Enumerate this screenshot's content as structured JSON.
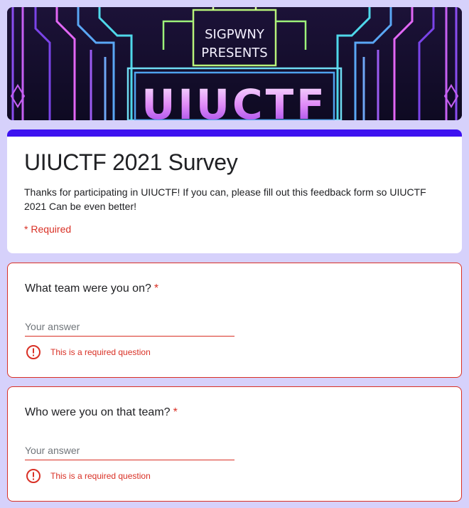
{
  "banner": {
    "line1": "SIGPWNY",
    "line2": "PRESENTS",
    "logo": "UIUCTF"
  },
  "form": {
    "title": "UIUCTF 2021 Survey",
    "description": "Thanks for participating in UIUCTF! If you can, please fill out this feedback form so UIUCTF 2021 Can be even better!",
    "required_note": "* Required"
  },
  "questions": [
    {
      "label": "What team were you on?",
      "required_mark": "*",
      "placeholder": "Your answer",
      "error": "This is a required question"
    },
    {
      "label": "Who were you on that team?",
      "required_mark": "*",
      "placeholder": "Your answer",
      "error": "This is a required question"
    }
  ],
  "colors": {
    "page_bg": "#d6d1fb",
    "accent": "#3d12f0",
    "error": "#d93025"
  },
  "icons": {
    "error": "alert-circle-icon"
  }
}
